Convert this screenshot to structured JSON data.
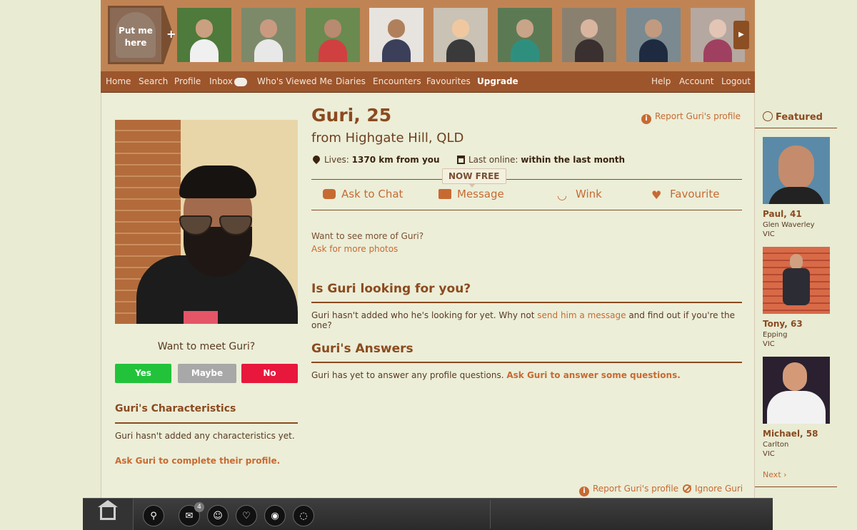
{
  "photo_strip": {
    "self_label": "Put me here",
    "add_symbol": "+",
    "next_symbol": "▶",
    "thumbnails": [
      {
        "bg": "#4e7a3c",
        "head": "#c9a080",
        "body": "#f0f0f0"
      },
      {
        "bg": "#7c8a6a",
        "head": "#c99a80",
        "body": "#e8e8e8"
      },
      {
        "bg": "#6a8a50",
        "head": "#b88a70",
        "body": "#d04040"
      },
      {
        "bg": "#e7e3df",
        "head": "#b0805c",
        "body": "#3b3f5a"
      },
      {
        "bg": "#c9c2b5",
        "head": "#f0c8a0",
        "body": "#3a3a3a"
      },
      {
        "bg": "#5b7a54",
        "head": "#c8a488",
        "body": "#2f8f7f"
      },
      {
        "bg": "#8a8070",
        "head": "#d9b5a0",
        "body": "#3a3030"
      },
      {
        "bg": "#7a8a90",
        "head": "#c29a80",
        "body": "#1e2a40"
      },
      {
        "bg": "#b5a8a0",
        "head": "#e2c5b5",
        "body": "#a04060"
      }
    ]
  },
  "nav": {
    "left": [
      "Home",
      "Search",
      "Profile",
      "Inbox",
      "Who's Viewed Me",
      "Diaries",
      "Encounters",
      "Favourites",
      "Upgrade"
    ],
    "right": [
      "Help",
      "Account",
      "Logout"
    ]
  },
  "profile": {
    "name_age": "Guri, 25",
    "location": "from Highgate Hill, QLD",
    "lives_label": "Lives:",
    "lives_value": "1370 km from you",
    "online_label": "Last online:",
    "online_value": "within the last month",
    "report_label": "Report Guri's profile",
    "now_free": "NOW FREE",
    "actions": {
      "chat": "Ask to Chat",
      "message": "Message",
      "wink": "Wink",
      "favourite": "Favourite"
    },
    "see_more": "Want to see more of Guri?",
    "ask_photos": "Ask for more photos",
    "looking_title": "Is Guri looking for you?",
    "looking_text_1": "Guri hasn't added who he's looking for yet. Why not ",
    "looking_link": "send him a message",
    "looking_text_2": " and find out if you're the one?",
    "answers_title": "Guri's Answers",
    "answers_text": "Guri has yet to answer any profile questions. ",
    "answers_link": "Ask Guri to answer some questions.",
    "meet_question": "Want to meet Guri?",
    "meet_buttons": {
      "yes": "Yes",
      "maybe": "Maybe",
      "no": "No"
    },
    "characteristics_title": "Guri's Characteristics",
    "characteristics_text": "Guri hasn't added any characteristics yet.",
    "characteristics_link": "Ask Guri to complete their profile.",
    "report_bottom": "Report Guri's profile",
    "ignore": "Ignore Guri"
  },
  "featured": {
    "title": "Featured",
    "users": [
      {
        "name": "Paul, 41",
        "suburb": "Glen Waverley",
        "state": "VIC"
      },
      {
        "name": "Tony, 63",
        "suburb": "Epping",
        "state": "VIC"
      },
      {
        "name": "Michael, 58",
        "suburb": "Carlton",
        "state": "VIC"
      }
    ],
    "next_label": "Next"
  },
  "bottombar": {
    "inbox_count": "4"
  },
  "colors": {
    "accent": "#c76a32",
    "brand_dark": "#8b4a1f",
    "nav_bg": "#9d552c",
    "yes": "#22c33a",
    "maybe": "#a8a8a8",
    "no": "#e8173c"
  }
}
